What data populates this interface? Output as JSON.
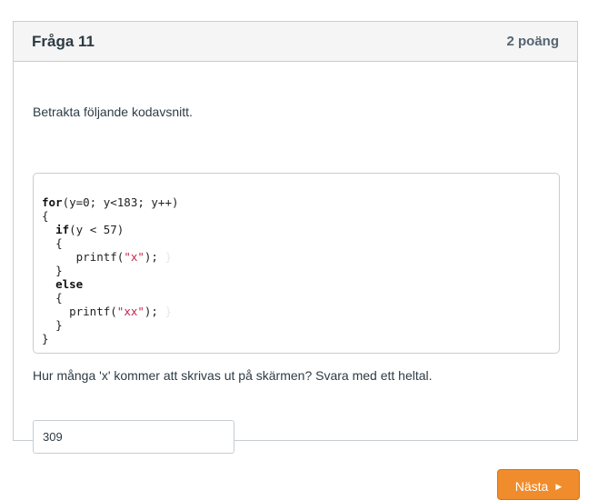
{
  "question": {
    "title": "Fråga 11",
    "points": "2 poäng",
    "intro": "Betrakta följande kodavsnitt.",
    "code": {
      "for_kw": "for",
      "for_rest": "(y=0; y<183; y++)",
      "open_brace": "{",
      "if_kw": "if",
      "if_rest": "(y < 57)",
      "if_open": "{",
      "printf_x_pre": "printf(",
      "printf_x_str": "\"x\"",
      "printf_x_post": ");",
      "if_close": "}",
      "else_kw": "else",
      "else_open": "{",
      "printf_xx_pre": "printf(",
      "printf_xx_str": "\"xx\"",
      "printf_xx_post": ");",
      "else_close": "}",
      "close_brace": "}"
    },
    "prompt": "Hur många 'x' kommer att skrivas ut på skärmen? Svara med ett heltal.",
    "answer_value": "309"
  },
  "navigation": {
    "next_label": "Nästa",
    "next_icon": "caret-right-icon"
  },
  "colors": {
    "accent": "#f08c2c",
    "border": "#c7cdd1",
    "header_bg": "#f5f5f5",
    "string": "#c7254e"
  }
}
